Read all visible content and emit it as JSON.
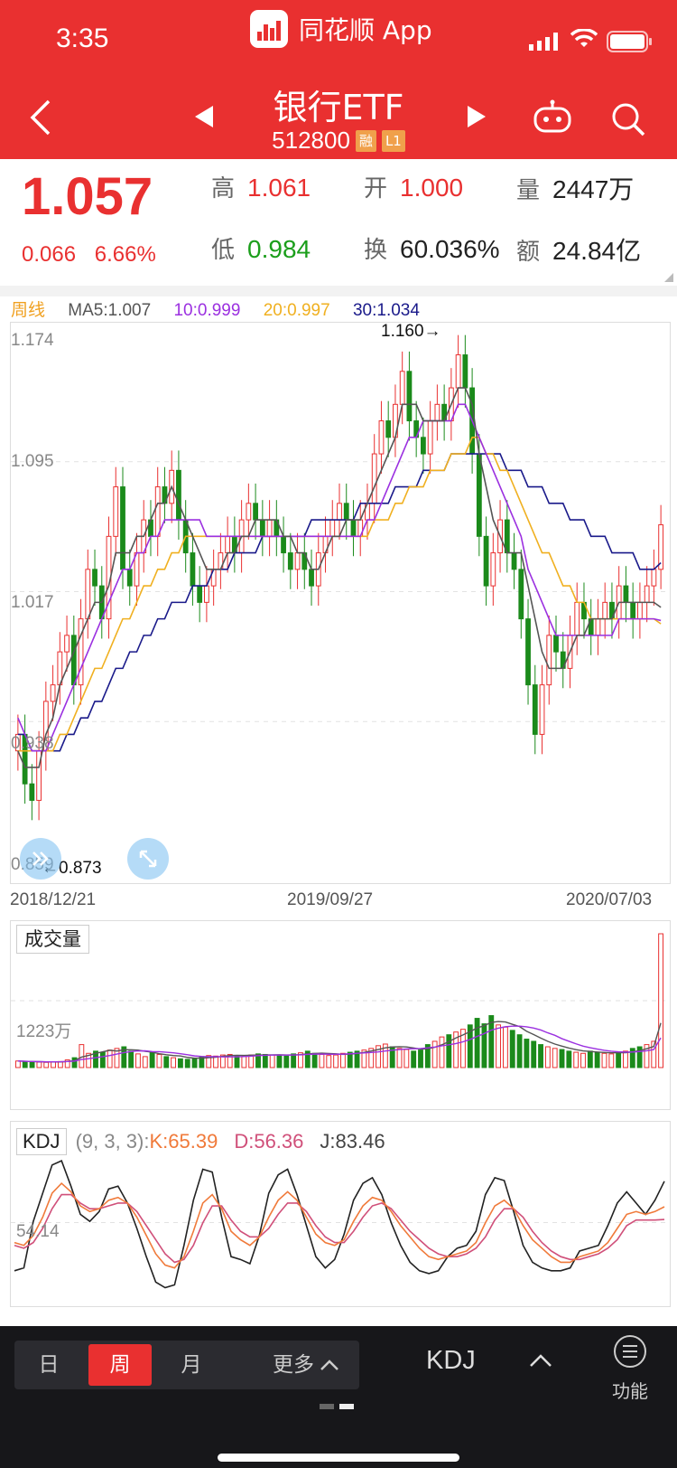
{
  "status_bar": {
    "time": "3:35",
    "app_name": "同花顺 App"
  },
  "nav": {
    "title": "银行ETF",
    "code": "512800",
    "tag_margin": "融",
    "tag_level": "L1"
  },
  "quote": {
    "price": "1.057",
    "change": "0.066",
    "change_pct": "6.66%",
    "high_label": "高",
    "high": "1.061",
    "open_label": "开",
    "open": "1.000",
    "volume_label": "量",
    "volume": "2447万",
    "low_label": "低",
    "low": "0.984",
    "turnover_label": "换",
    "turnover": "60.036%",
    "amount_label": "额",
    "amount": "24.84亿"
  },
  "legend": {
    "period": "周线",
    "ma5": "MA5:1.007",
    "ma10": "10:0.999",
    "ma20": "20:0.997",
    "ma30": "30:1.034"
  },
  "colors": {
    "up": "#e93030",
    "down": "#1b8a1b",
    "ma5": "#555555",
    "ma10": "#9b30e0",
    "ma20": "#f0b020",
    "ma30": "#1a1a8a",
    "k": "#f07a3a",
    "d": "#d0507a",
    "j": "#222222"
  },
  "chart_data": [
    {
      "type": "candlestick",
      "title": "周线",
      "y_ticks": [
        "1.174",
        "1.095",
        "1.017",
        "0.938",
        "0.859"
      ],
      "ylim": [
        0.859,
        1.174
      ],
      "x_ticks": [
        "2018/12/21",
        "2019/09/27",
        "2020/07/03"
      ],
      "max_marker": "1.160→",
      "min_marker": "←0.873",
      "close": [
        0.93,
        0.9,
        0.89,
        0.92,
        0.95,
        0.96,
        0.98,
        0.99,
        0.96,
        1.0,
        1.03,
        1.02,
        1.0,
        1.05,
        1.08,
        1.03,
        1.02,
        1.04,
        1.06,
        1.05,
        1.08,
        1.07,
        1.09,
        1.06,
        1.04,
        1.02,
        1.01,
        1.02,
        1.03,
        1.04,
        1.05,
        1.04,
        1.06,
        1.07,
        1.06,
        1.05,
        1.06,
        1.05,
        1.04,
        1.03,
        1.04,
        1.03,
        1.02,
        1.04,
        1.05,
        1.06,
        1.07,
        1.06,
        1.05,
        1.06,
        1.07,
        1.1,
        1.12,
        1.11,
        1.13,
        1.15,
        1.12,
        1.11,
        1.1,
        1.12,
        1.13,
        1.12,
        1.14,
        1.16,
        1.14,
        1.1,
        1.05,
        1.02,
        1.04,
        1.06,
        1.04,
        1.03,
        1.0,
        0.96,
        0.93,
        0.96,
        0.99,
        0.98,
        0.97,
        0.99,
        1.01,
        1.0,
        0.99,
        1.0,
        1.01,
        1.0,
        1.02,
        1.01,
        1.0,
        1.01,
        1.02,
        1.03,
        1.057
      ],
      "open_offset_note": "",
      "ma5": [
        0.92,
        0.91,
        0.91,
        0.91,
        0.93,
        0.94,
        0.96,
        0.97,
        0.98,
        0.99,
        1.0,
        1.01,
        1.01,
        1.02,
        1.04,
        1.04,
        1.04,
        1.05,
        1.05,
        1.06,
        1.07,
        1.07,
        1.08,
        1.07,
        1.06,
        1.05,
        1.04,
        1.03,
        1.03,
        1.03,
        1.04,
        1.04,
        1.05,
        1.05,
        1.06,
        1.06,
        1.06,
        1.06,
        1.05,
        1.05,
        1.04,
        1.04,
        1.03,
        1.03,
        1.04,
        1.05,
        1.05,
        1.06,
        1.06,
        1.06,
        1.07,
        1.08,
        1.09,
        1.1,
        1.11,
        1.13,
        1.13,
        1.13,
        1.12,
        1.12,
        1.12,
        1.12,
        1.13,
        1.14,
        1.14,
        1.13,
        1.1,
        1.08,
        1.06,
        1.05,
        1.04,
        1.04,
        1.04,
        1.02,
        1.0,
        0.98,
        0.97,
        0.97,
        0.97,
        0.98,
        0.99,
        0.99,
        1.0,
        1.0,
        1.0,
        1.0,
        1.01,
        1.01,
        1.01,
        1.01,
        1.01,
        1.01,
        1.007
      ],
      "ma10": [
        0.94,
        0.93,
        0.92,
        0.92,
        0.92,
        0.93,
        0.94,
        0.95,
        0.96,
        0.97,
        0.98,
        0.99,
        1.0,
        1.01,
        1.02,
        1.03,
        1.03,
        1.04,
        1.04,
        1.05,
        1.05,
        1.06,
        1.06,
        1.06,
        1.06,
        1.06,
        1.06,
        1.05,
        1.05,
        1.05,
        1.05,
        1.05,
        1.05,
        1.05,
        1.05,
        1.05,
        1.05,
        1.05,
        1.05,
        1.05,
        1.05,
        1.05,
        1.05,
        1.05,
        1.05,
        1.05,
        1.05,
        1.05,
        1.05,
        1.05,
        1.06,
        1.06,
        1.07,
        1.08,
        1.09,
        1.1,
        1.11,
        1.11,
        1.12,
        1.12,
        1.12,
        1.12,
        1.12,
        1.13,
        1.13,
        1.12,
        1.11,
        1.1,
        1.09,
        1.08,
        1.07,
        1.06,
        1.05,
        1.03,
        1.02,
        1.01,
        1.0,
        0.99,
        0.99,
        0.99,
        0.99,
        0.99,
        0.99,
        0.99,
        0.99,
        0.99,
        1.0,
        1.0,
        1.0,
        1.0,
        1.0,
        1.0,
        0.999
      ],
      "ma20": [
        0.92,
        0.92,
        0.92,
        0.92,
        0.92,
        0.92,
        0.93,
        0.93,
        0.94,
        0.95,
        0.96,
        0.97,
        0.97,
        0.98,
        0.99,
        1.0,
        1.0,
        1.01,
        1.02,
        1.02,
        1.03,
        1.03,
        1.04,
        1.04,
        1.05,
        1.05,
        1.05,
        1.05,
        1.05,
        1.05,
        1.05,
        1.05,
        1.05,
        1.05,
        1.05,
        1.05,
        1.05,
        1.05,
        1.05,
        1.05,
        1.05,
        1.05,
        1.05,
        1.05,
        1.05,
        1.05,
        1.05,
        1.05,
        1.05,
        1.05,
        1.05,
        1.06,
        1.06,
        1.06,
        1.07,
        1.07,
        1.08,
        1.08,
        1.08,
        1.09,
        1.09,
        1.09,
        1.1,
        1.1,
        1.1,
        1.11,
        1.11,
        1.1,
        1.1,
        1.09,
        1.09,
        1.08,
        1.07,
        1.06,
        1.05,
        1.04,
        1.04,
        1.03,
        1.02,
        1.02,
        1.01,
        1.01,
        1.0,
        1.0,
        1.0,
        1.0,
        1.0,
        1.0,
        1.0,
        1.0,
        1.0,
        1.0,
        0.997
      ],
      "ma30": [
        0.93,
        0.93,
        0.92,
        0.92,
        0.92,
        0.92,
        0.92,
        0.93,
        0.93,
        0.94,
        0.94,
        0.95,
        0.95,
        0.96,
        0.97,
        0.97,
        0.98,
        0.98,
        0.99,
        0.99,
        1.0,
        1.0,
        1.01,
        1.01,
        1.01,
        1.02,
        1.02,
        1.02,
        1.03,
        1.03,
        1.03,
        1.04,
        1.04,
        1.04,
        1.04,
        1.05,
        1.05,
        1.05,
        1.05,
        1.05,
        1.05,
        1.05,
        1.06,
        1.06,
        1.06,
        1.06,
        1.06,
        1.06,
        1.06,
        1.07,
        1.07,
        1.07,
        1.07,
        1.07,
        1.08,
        1.08,
        1.08,
        1.08,
        1.09,
        1.09,
        1.09,
        1.09,
        1.1,
        1.1,
        1.1,
        1.1,
        1.1,
        1.1,
        1.1,
        1.1,
        1.09,
        1.09,
        1.09,
        1.08,
        1.08,
        1.08,
        1.07,
        1.07,
        1.07,
        1.06,
        1.06,
        1.06,
        1.05,
        1.05,
        1.05,
        1.04,
        1.04,
        1.04,
        1.04,
        1.03,
        1.03,
        1.03,
        1.034
      ]
    },
    {
      "type": "bar",
      "title": "成交量",
      "y_label": "1223万",
      "volume_wan": [
        120,
        110,
        100,
        100,
        95,
        105,
        110,
        140,
        180,
        420,
        260,
        300,
        280,
        320,
        350,
        380,
        300,
        250,
        200,
        280,
        240,
        200,
        180,
        160,
        150,
        170,
        200,
        220,
        210,
        230,
        240,
        220,
        210,
        230,
        250,
        240,
        230,
        220,
        210,
        250,
        270,
        300,
        260,
        240,
        220,
        230,
        260,
        280,
        300,
        320,
        350,
        400,
        430,
        380,
        350,
        330,
        300,
        320,
        420,
        480,
        560,
        600,
        650,
        700,
        780,
        900,
        800,
        950,
        780,
        740,
        680,
        600,
        520,
        480,
        420,
        380,
        350,
        330,
        300,
        280,
        260,
        300,
        280,
        260,
        250,
        270,
        300,
        350,
        380,
        420,
        480,
        2447
      ],
      "red_ratio_note": ""
    },
    {
      "type": "line",
      "title": "KDJ",
      "params": "(9, 3, 3):",
      "k_label": "K:65.39",
      "d_label": "D:56.36",
      "j_label": "J:83.46",
      "y_label": "54.14",
      "k": [
        40,
        38,
        45,
        58,
        75,
        82,
        76,
        66,
        62,
        64,
        70,
        72,
        68,
        58,
        45,
        32,
        24,
        22,
        30,
        48,
        68,
        74,
        64,
        48,
        42,
        38,
        44,
        58,
        70,
        76,
        70,
        58,
        46,
        40,
        38,
        42,
        55,
        66,
        72,
        70,
        62,
        52,
        44,
        36,
        30,
        28,
        30,
        32,
        34,
        40,
        54,
        66,
        70,
        64,
        52,
        42,
        36,
        30,
        26,
        26,
        30,
        32,
        34,
        40,
        50,
        60,
        62,
        60,
        62,
        65.39
      ],
      "d": [
        38,
        36,
        40,
        50,
        64,
        74,
        74,
        68,
        64,
        64,
        66,
        68,
        68,
        62,
        52,
        42,
        32,
        26,
        28,
        38,
        54,
        66,
        66,
        56,
        48,
        44,
        44,
        50,
        60,
        68,
        68,
        62,
        52,
        44,
        40,
        40,
        48,
        58,
        66,
        68,
        64,
        56,
        48,
        42,
        36,
        32,
        30,
        30,
        32,
        36,
        44,
        56,
        64,
        64,
        58,
        48,
        40,
        34,
        30,
        28,
        28,
        30,
        32,
        36,
        42,
        52,
        56,
        56,
        56,
        56.36
      ],
      "j": [
        20,
        22,
        55,
        75,
        95,
        98,
        80,
        60,
        55,
        62,
        78,
        80,
        68,
        50,
        30,
        12,
        8,
        10,
        38,
        70,
        92,
        90,
        58,
        30,
        28,
        25,
        45,
        75,
        88,
        92,
        74,
        52,
        30,
        22,
        28,
        46,
        70,
        82,
        86,
        74,
        54,
        38,
        26,
        20,
        18,
        20,
        30,
        36,
        38,
        48,
        74,
        86,
        84,
        62,
        38,
        26,
        22,
        20,
        20,
        22,
        34,
        36,
        38,
        52,
        68,
        76,
        68,
        60,
        70,
        83.46
      ]
    }
  ],
  "toolbar": {
    "day": "日",
    "week": "周",
    "month": "月",
    "more": "更多",
    "indicator": "KDJ",
    "func": "功能"
  }
}
